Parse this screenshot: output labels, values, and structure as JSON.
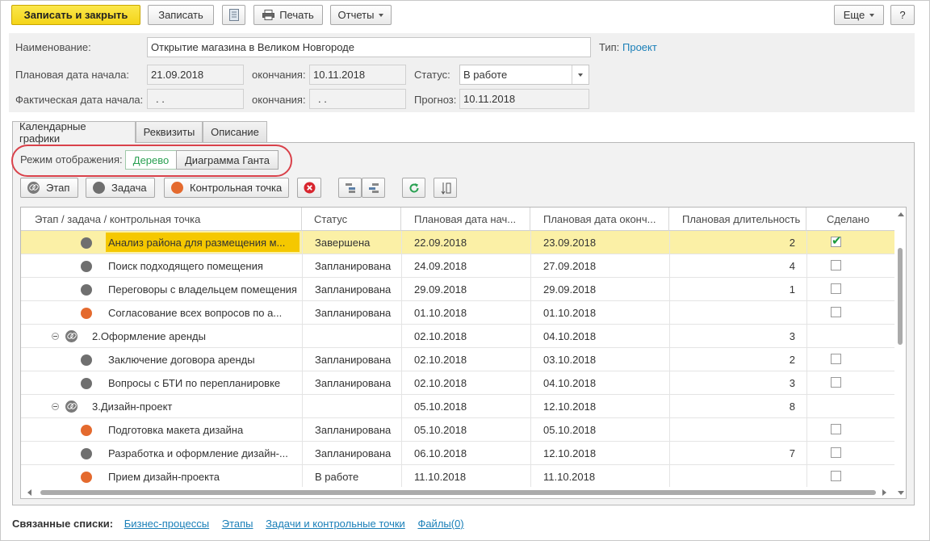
{
  "toolbar": {
    "save_close": "Записать и закрыть",
    "save": "Записать",
    "print": "Печать",
    "reports": "Отчеты",
    "more": "Еще",
    "help": "?"
  },
  "form": {
    "name_label": "Наименование:",
    "name_value": "Открытие магазина в Великом Новгороде",
    "type_label": "Тип:",
    "type_value": "Проект",
    "plan_start_label": "Плановая дата начала:",
    "plan_start_value": "21.09.2018",
    "plan_end_label": "окончания:",
    "plan_end_value": "10.11.2018",
    "status_label": "Статус:",
    "status_value": "В работе",
    "fact_start_label": "Фактическая дата начала:",
    "fact_start_value": " .  .",
    "fact_end_label": "окончания:",
    "fact_end_value": " .  .",
    "forecast_label": "Прогноз:",
    "forecast_value": "10.11.2018"
  },
  "tabs": [
    "Календарные графики",
    "Реквизиты",
    "Описание"
  ],
  "mode": {
    "label": "Режим отображения:",
    "tree": "Дерево",
    "gantt": "Диаграмма Ганта"
  },
  "grid_toolbar": {
    "stage": "Этап",
    "task": "Задача",
    "milestone": "Контрольная точка"
  },
  "columns": [
    "Этап / задача / контрольная точка",
    "Статус",
    "Плановая дата нач...",
    "Плановая дата оконч...",
    "Плановая длительность",
    "Сделано"
  ],
  "rows": [
    {
      "name": "Анализ района для размещения м...",
      "status": "Завершена",
      "start": "22.09.2018",
      "end": "23.09.2018",
      "dur": "2",
      "done": "yes"
    },
    {
      "name": "Поиск подходящего помещения",
      "status": "Запланирована",
      "start": "24.09.2018",
      "end": "27.09.2018",
      "dur": "4",
      "done": "no"
    },
    {
      "name": "Переговоры с владельцем помещения",
      "status": "Запланирована",
      "start": "29.09.2018",
      "end": "29.09.2018",
      "dur": "1",
      "done": "no"
    },
    {
      "name": "Согласование всех вопросов по а...",
      "status": "Запланирована",
      "start": "01.10.2018",
      "end": "01.10.2018",
      "dur": "",
      "done": "no"
    },
    {
      "name": "2.Оформление аренды",
      "status": "",
      "start": "02.10.2018",
      "end": "04.10.2018",
      "dur": "3",
      "done": ""
    },
    {
      "name": "Заключение договора аренды",
      "status": "Запланирована",
      "start": "02.10.2018",
      "end": "03.10.2018",
      "dur": "2",
      "done": "no"
    },
    {
      "name": "Вопросы с БТИ по перепланировке",
      "status": "Запланирована",
      "start": "02.10.2018",
      "end": "04.10.2018",
      "dur": "3",
      "done": "no"
    },
    {
      "name": "3.Дизайн-проект",
      "status": "",
      "start": "05.10.2018",
      "end": "12.10.2018",
      "dur": "8",
      "done": ""
    },
    {
      "name": "Подготовка макета дизайна",
      "status": "Запланирована",
      "start": "05.10.2018",
      "end": "05.10.2018",
      "dur": "",
      "done": "no"
    },
    {
      "name": "Разработка и оформление дизайн-...",
      "status": "Запланирована",
      "start": "06.10.2018",
      "end": "12.10.2018",
      "dur": "7",
      "done": "no"
    },
    {
      "name": "Прием дизайн-проекта",
      "status": "В работе",
      "start": "11.10.2018",
      "end": "11.10.2018",
      "dur": "",
      "done": "no"
    }
  ],
  "footer": {
    "title": "Связанные списки:",
    "links": [
      "Бизнес-процессы",
      "Этапы",
      "Задачи и контрольные точки",
      "Файлы(0)"
    ]
  },
  "colors": {
    "accent": "#f4d419",
    "link": "#1a7fb8",
    "selected_row": "#fbf0a6",
    "milestone": "#e46a2e",
    "task": "#6f6f6f",
    "highlight": "#d9414a"
  }
}
